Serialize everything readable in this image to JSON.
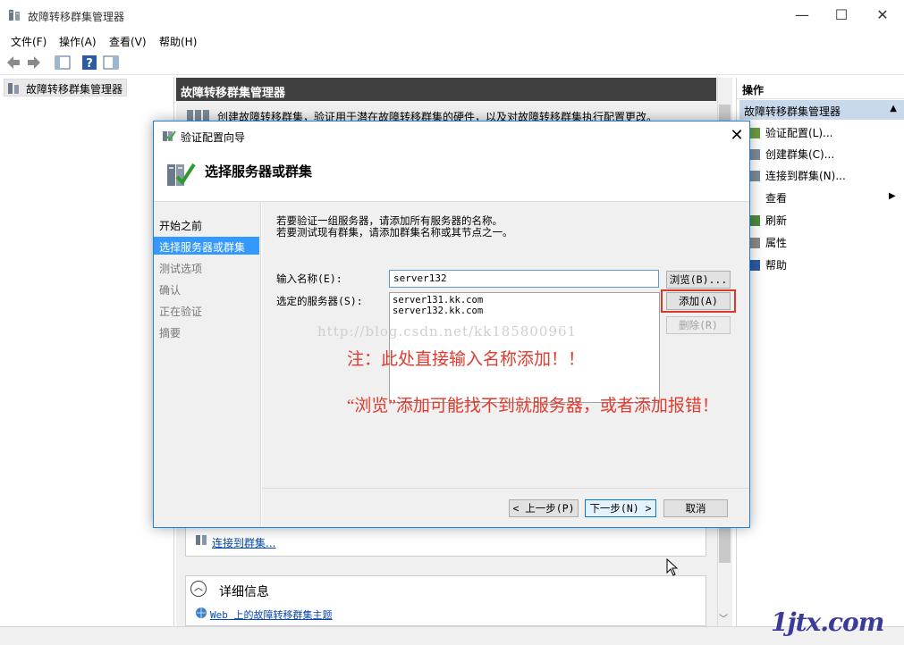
{
  "window": {
    "title": "故障转移群集管理器",
    "controls": {
      "minimize": "—",
      "maximize": "☐",
      "close": "✕"
    }
  },
  "menu": [
    "文件(F)",
    "操作(A)",
    "查看(V)",
    "帮助(H)"
  ],
  "tree": {
    "root": "故障转移群集管理器"
  },
  "center": {
    "header": "故障转移群集管理器",
    "intro_text": "创建故障转移群集，验证用于潜在故障转移群集的硬件，以及对故障转移群集执行配置更改。",
    "connect_link": "连接到群集...",
    "details_label": "详细信息",
    "web_link": "Web 上的故障转移群集主题"
  },
  "actions": {
    "header": "操作",
    "group": "故障转移群集管理器",
    "items": [
      "验证配置(L)...",
      "创建群集(C)...",
      "连接到群集(N)...",
      "查看",
      "刷新",
      "属性",
      "帮助"
    ]
  },
  "dialog": {
    "title": "验证配置向导",
    "heading": "选择服务器或群集",
    "steps": [
      "开始之前",
      "选择服务器或群集",
      "测试选项",
      "确认",
      "正在验证",
      "摘要"
    ],
    "desc_line1": "若要验证一组服务器，请添加所有服务器的名称。",
    "desc_line2": "若要测试现有群集，请添加群集名称或其节点之一。",
    "enter_name_label": "输入名称(E):",
    "enter_name_value": "server132",
    "selected_label": "选定的服务器(S):",
    "selected_servers": [
      "server131.kk.com",
      "server132.kk.com"
    ],
    "browse_btn": "浏览(B)...",
    "add_btn": "添加(A)",
    "remove_btn": "删除(R)",
    "prev_btn": "< 上一步(P)",
    "next_btn": "下一步(N) >",
    "cancel_btn": "取消"
  },
  "annotations": {
    "watermark": "http://blog.csdn.net/kk185800961",
    "note1": "注：此处直接输入名称添加！！",
    "note2": "“浏览”添加可能找不到就服务器，或者添加报错！"
  },
  "logo": "1jtx.com",
  "colors": {
    "accent": "#3399ff",
    "note": "#e03a2e",
    "header": "#404040",
    "action_group": "#c9d9ec"
  }
}
